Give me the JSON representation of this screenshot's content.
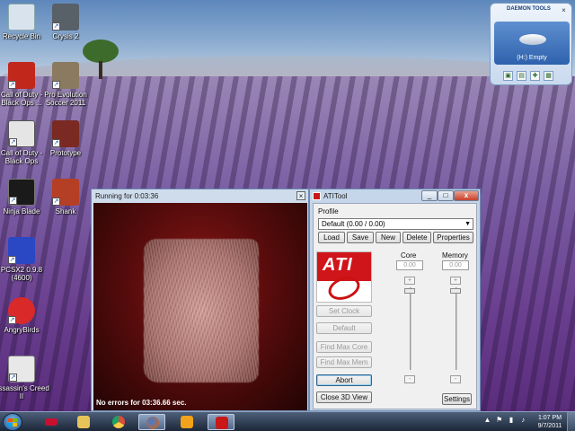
{
  "desktop": {
    "icons": [
      {
        "label": "Recycle Bin",
        "icon": "recycle-bin-icon",
        "color": "#d9e3ee"
      },
      {
        "label": "Crysis 2",
        "icon": "crysis-icon",
        "color": "#586068"
      },
      {
        "label": "Call of Duty - Black Ops ...",
        "icon": "cod-icon",
        "color": "#c1271b"
      },
      {
        "label": "Pro Evolution Soccer 2011",
        "icon": "pes-icon",
        "color": "#8a7a60"
      },
      {
        "label": "Call of Duty - Black Ops",
        "icon": "cod-icon",
        "color": "#e5e5e5"
      },
      {
        "label": "Prototype",
        "icon": "prototype-icon",
        "color": "#7a2a22"
      },
      {
        "label": "Ninja Blade",
        "icon": "ninja-blade-icon",
        "color": "#1a1a1a"
      },
      {
        "label": "Shank",
        "icon": "shank-icon",
        "color": "#b53f25"
      },
      {
        "label": "PCSX2 0.9.8 (4600)",
        "icon": "pcsx2-icon",
        "color": "#2b48c4"
      },
      {
        "label": "AngryBirds",
        "icon": "angry-birds-icon",
        "color": "#d92929"
      },
      {
        "label": "Assassin's Creed II",
        "icon": "assassins-creed-icon",
        "color": "#e8e8e8"
      }
    ]
  },
  "daemon_tools": {
    "brand": "DAEMON TOOLS",
    "drive_label": "(H:) Empty",
    "close": "×",
    "toolbar_icons": [
      "mount-icon",
      "unmount-icon",
      "add-drive-icon",
      "catalog-icon"
    ]
  },
  "running_window": {
    "title": "Running for 0:03:36",
    "close": "×",
    "status": "No errors for 03:36.66 sec."
  },
  "ati_window": {
    "title": "ATITool",
    "min": "_",
    "max": "□",
    "close": "x",
    "profile_label": "Profile",
    "profile_value": "Default (0.00 / 0.00)",
    "profile_buttons": [
      "Load",
      "Save",
      "New",
      "Delete",
      "Properties"
    ],
    "logo_text": "ATI",
    "core_label": "Core",
    "memory_label": "Memory",
    "core_value": "0.00",
    "memory_value": "0.00",
    "plus": "+",
    "minus": "-",
    "set_clock": "Set Clock",
    "default": "Default",
    "find_max_core": "Find Max Core",
    "find_max_mem": "Find Max Mem",
    "abort": "Abort",
    "close_3d_view": "Close 3D View",
    "settings": "Settings"
  },
  "taskbar": {
    "pinned": [
      {
        "name": "amd-icon",
        "color": "#c8102e",
        "active": false
      },
      {
        "name": "explorer-icon",
        "color": "#e7c45a",
        "active": false
      },
      {
        "name": "chrome-icon",
        "color": "#dd4b39",
        "active": false
      },
      {
        "name": "firefox-icon",
        "color": "#e66000",
        "active": true
      },
      {
        "name": "media-player-icon",
        "color": "#f3a21b",
        "active": false
      },
      {
        "name": "atitool-icon",
        "color": "#c81818",
        "active": true
      }
    ],
    "time": "1:07 PM",
    "date": "9/7/2011",
    "tray_glyphs": [
      "▲",
      "⚑",
      "▮",
      "♪"
    ]
  }
}
